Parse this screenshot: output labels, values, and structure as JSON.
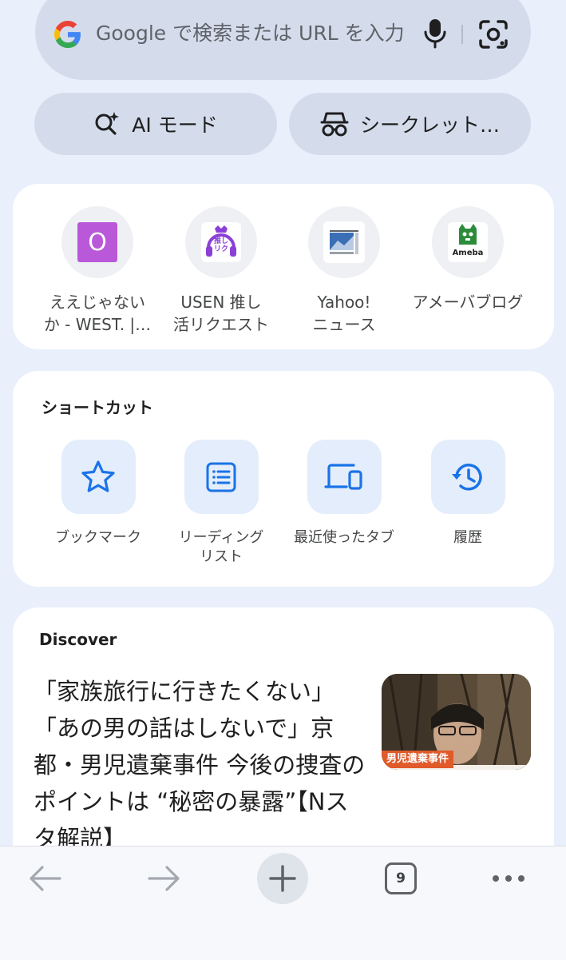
{
  "search": {
    "placeholder": "Google で検索または URL を入力"
  },
  "pills": {
    "ai_mode": "AI モード",
    "incognito": "シークレット…"
  },
  "most_visited": [
    {
      "label": "ええじゃない\nか - WEST. |…",
      "icon": "letter-o-tile",
      "tile_text": "O",
      "color": "#b959d9"
    },
    {
      "label": "USEN 推し\n活リクエスト",
      "icon": "usen-oshikatsu-logo",
      "tile_text": "推し\nリク",
      "color": "#8b3fd9"
    },
    {
      "label": "Yahoo!\nニュース",
      "icon": "yahoo-news-logo"
    },
    {
      "label": "アメーバブログ",
      "icon": "ameba-logo",
      "tile_text": "Ameba",
      "color": "#2d8c3c"
    }
  ],
  "shortcuts": {
    "title": "ショートカット",
    "items": [
      {
        "label": "ブックマーク",
        "icon": "star-icon"
      },
      {
        "label": "リーディング\nリスト",
        "icon": "reading-list-icon"
      },
      {
        "label": "最近使ったタブ",
        "icon": "recent-tabs-icon"
      },
      {
        "label": "履歴",
        "icon": "history-icon"
      }
    ]
  },
  "discover": {
    "title": "Discover",
    "article": {
      "title": "「家族旅行に行きたくない」「あの男の話はしないで」京都・男児遺棄事件 今後の捜査のポイントは “秘密の暴露”【Nスタ解説】",
      "thumb_badge": "男児遺棄事件"
    }
  },
  "toolbar": {
    "tab_count": "9"
  },
  "colors": {
    "background": "#e9f0fc",
    "pill": "#d4dcec",
    "accent_blue": "#1a73e8"
  }
}
